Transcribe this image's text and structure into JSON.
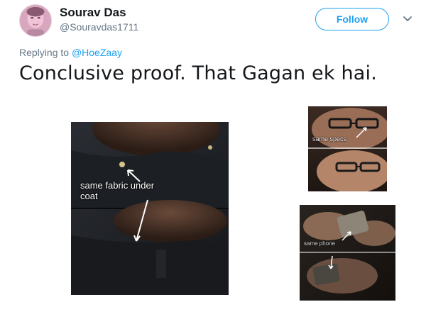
{
  "tweet": {
    "author": {
      "display_name": "Sourav Das",
      "handle": "@Souravdas1711"
    },
    "follow_label": "Follow",
    "replying_prefix": "Replying to",
    "replying_to": "@HoeZaay",
    "text": "Conclusive proof. That Gagan ek hai."
  },
  "media": {
    "left_caption": "same fabric under coat",
    "top_right_caption": "same specs",
    "bottom_right_caption": "same phone"
  },
  "colors": {
    "accent": "#1da1f2",
    "secondary_text": "#657786",
    "primary_text": "#14171a"
  },
  "icons": {
    "menu": "chevron-down-icon"
  }
}
